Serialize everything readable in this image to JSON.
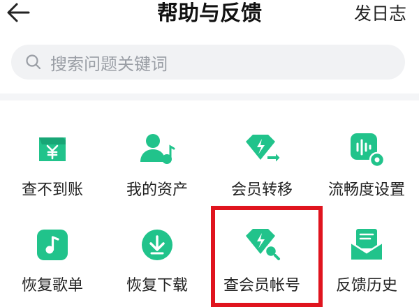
{
  "header": {
    "back_icon": "arrow-left-icon",
    "title": "帮助与反馈",
    "log_button": "发日志"
  },
  "search": {
    "icon": "search-icon",
    "placeholder": "搜索问题关键词"
  },
  "grid": {
    "accent_color": "#21c38b",
    "items": [
      {
        "label": "查不到账",
        "icon": "wallet-yen-icon"
      },
      {
        "label": "我的资产",
        "icon": "user-music-icon"
      },
      {
        "label": "会员转移",
        "icon": "diamond-transfer-icon"
      },
      {
        "label": "流畅度设置",
        "icon": "audio-settings-icon"
      },
      {
        "label": "恢复歌单",
        "icon": "music-note-icon"
      },
      {
        "label": "恢复下载",
        "icon": "download-icon"
      },
      {
        "label": "查会员帐号",
        "icon": "diamond-search-icon"
      },
      {
        "label": "反馈历史",
        "icon": "feedback-history-icon"
      }
    ]
  },
  "highlight_color": "#e0141e"
}
